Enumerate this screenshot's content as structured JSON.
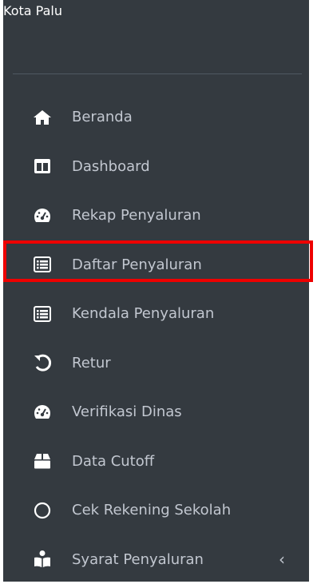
{
  "header": {
    "region": "Kota Palu"
  },
  "menu": {
    "items": [
      {
        "label": "Beranda",
        "icon": "home-icon"
      },
      {
        "label": "Dashboard",
        "icon": "columns-icon"
      },
      {
        "label": "Rekap Penyaluran",
        "icon": "tachometer-icon"
      },
      {
        "label": "Daftar Penyaluran",
        "icon": "list-icon",
        "active": true
      },
      {
        "label": "Kendala Penyaluran",
        "icon": "list-icon"
      },
      {
        "label": "Retur",
        "icon": "undo-icon"
      },
      {
        "label": "Verifikasi Dinas",
        "icon": "tachometer-icon"
      },
      {
        "label": "Data Cutoff",
        "icon": "box-icon"
      },
      {
        "label": "Cek Rekening Sekolah",
        "icon": "circle-icon"
      },
      {
        "label": "Syarat Penyaluran",
        "icon": "reader-icon",
        "chevron": "‹"
      }
    ]
  },
  "colors": {
    "sidebar_bg": "#343a40",
    "text": "#c2c7d0",
    "highlight": "#ee0000"
  }
}
